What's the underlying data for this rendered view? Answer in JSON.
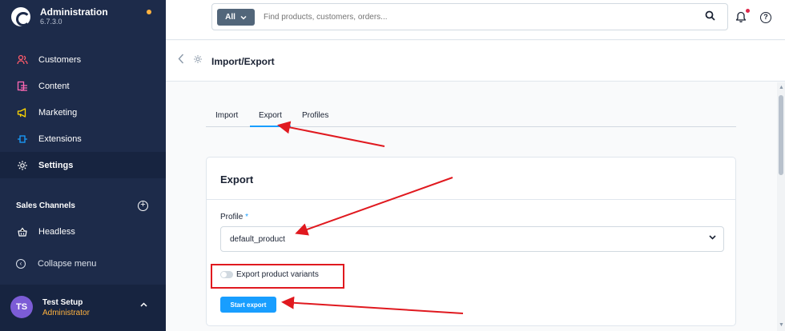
{
  "brand": {
    "title": "Administration",
    "version": "6.7.3.0"
  },
  "nav": {
    "items": [
      {
        "label": "Customers",
        "icon": "users-icon",
        "color": "#ff5a6a"
      },
      {
        "label": "Content",
        "icon": "content-icon",
        "color": "#ff68b4"
      },
      {
        "label": "Marketing",
        "icon": "megaphone-icon",
        "color": "#ffd700"
      },
      {
        "label": "Extensions",
        "icon": "plug-icon",
        "color": "#189eff"
      },
      {
        "label": "Settings",
        "icon": "gear-icon",
        "color": "#ffffff"
      }
    ],
    "sales_channels_label": "Sales Channels",
    "headless_label": "Headless",
    "collapse_label": "Collapse menu"
  },
  "user": {
    "initials": "TS",
    "name": "Test Setup",
    "role": "Administrator"
  },
  "search": {
    "scope": "All",
    "placeholder": "Find products, customers, orders..."
  },
  "page": {
    "title": "Import/Export"
  },
  "tabs": [
    {
      "label": "Import"
    },
    {
      "label": "Export"
    },
    {
      "label": "Profiles"
    }
  ],
  "card": {
    "title": "Export",
    "profile_label": "Profile",
    "required_mark": "*",
    "profile_value": "default_product",
    "variants_label": "Export product variants",
    "start_button": "Start export"
  },
  "colors": {
    "sidebar": "#1d2b4a",
    "accent": "#189eff",
    "annotation": "#e0191f",
    "warning": "#ffb23f"
  }
}
